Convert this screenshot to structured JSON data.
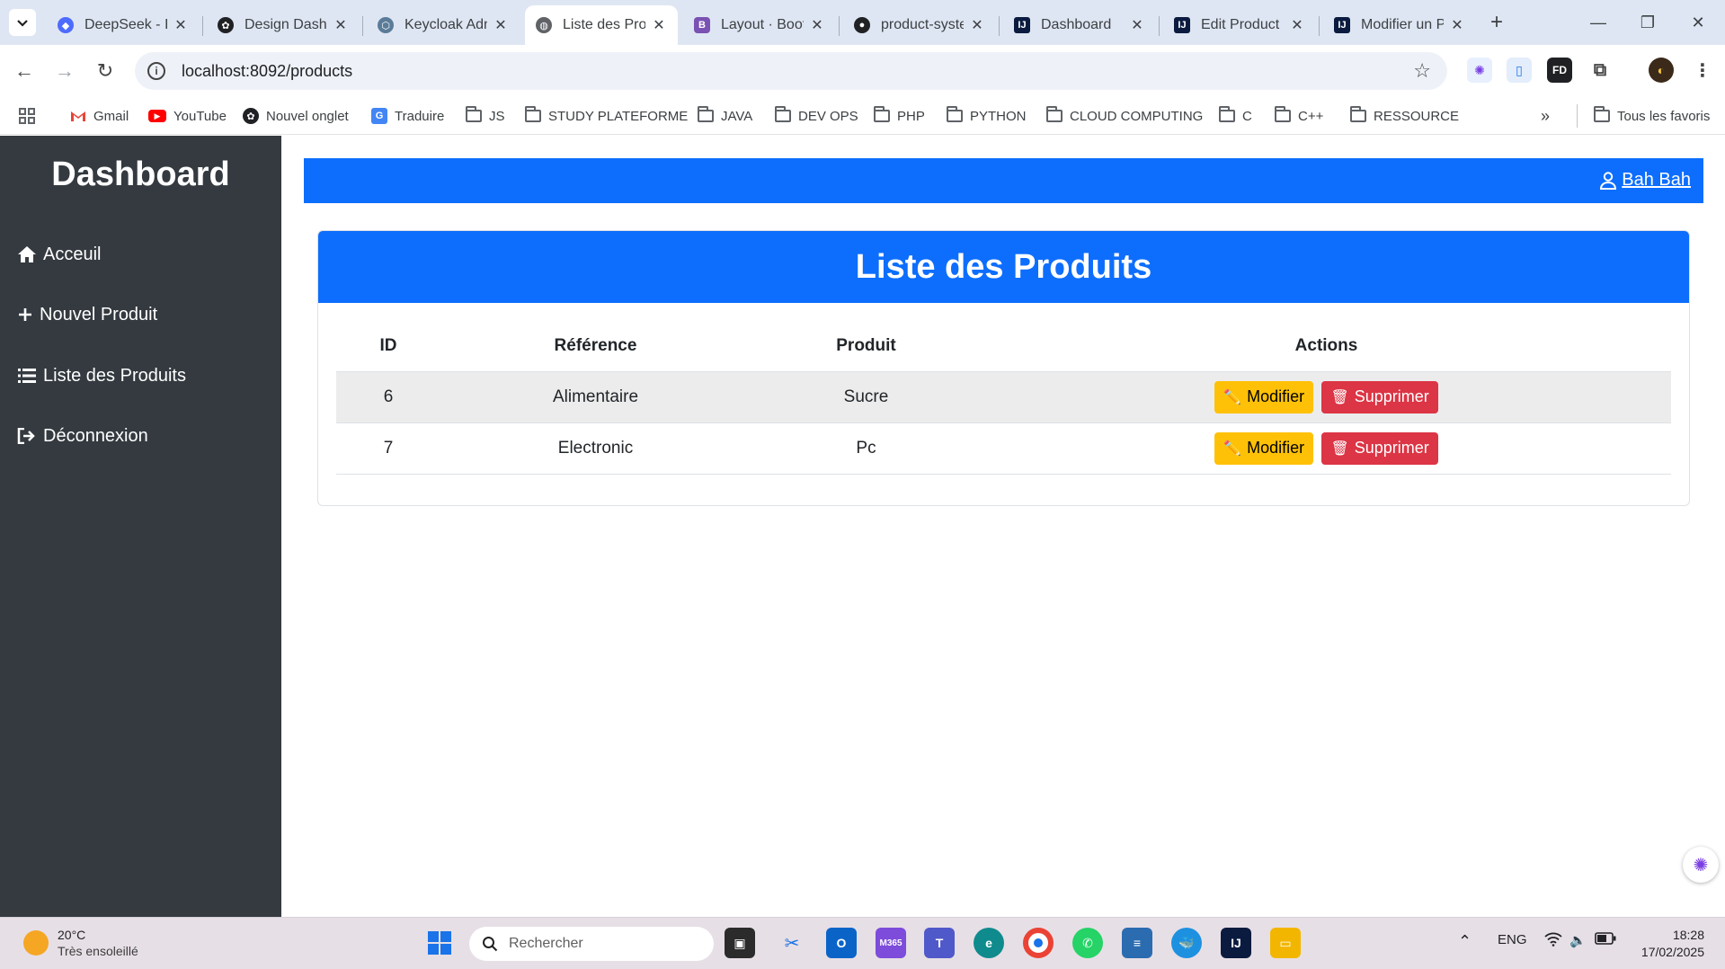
{
  "browser": {
    "tabs": [
      {
        "title": "DeepSeek - Ir",
        "favicon_color": "#4d6bfe",
        "active": false
      },
      {
        "title": "Design Dashb",
        "favicon_color": "#202124",
        "active": false
      },
      {
        "title": "Keycloak Adn",
        "favicon_color": "#5b7c99",
        "active": false
      },
      {
        "title": "Liste des Proc",
        "favicon_color": "#5f6368",
        "active": true
      },
      {
        "title": "Layout · Boot",
        "favicon_color": "#7952b3",
        "active": false
      },
      {
        "title": "product-syste",
        "favicon_color": "#202124",
        "active": false
      },
      {
        "title": "Dashboard",
        "favicon_color": "#0b1b3f",
        "active": false
      },
      {
        "title": "Edit Product",
        "favicon_color": "#0b1b3f",
        "active": false
      },
      {
        "title": "Modifier un P",
        "favicon_color": "#0b1b3f",
        "active": false
      }
    ],
    "url": "localhost:8092/products",
    "bookmarks": [
      {
        "label": "Gmail",
        "icon": "gmail-icon"
      },
      {
        "label": "YouTube",
        "icon": "youtube-icon"
      },
      {
        "label": "Nouvel onglet",
        "icon": "chatgpt-icon"
      },
      {
        "label": "Traduire",
        "icon": "translate-icon"
      },
      {
        "label": "JS",
        "icon": "folder-icon"
      },
      {
        "label": "STUDY PLATEFORME",
        "icon": "folder-icon"
      },
      {
        "label": "JAVA",
        "icon": "folder-icon"
      },
      {
        "label": "DEV OPS",
        "icon": "folder-icon"
      },
      {
        "label": "PHP",
        "icon": "folder-icon"
      },
      {
        "label": "PYTHON",
        "icon": "folder-icon"
      },
      {
        "label": "CLOUD COMPUTING",
        "icon": "folder-icon"
      },
      {
        "label": "C",
        "icon": "folder-icon"
      },
      {
        "label": "C++",
        "icon": "folder-icon"
      },
      {
        "label": "RESSOURCE",
        "icon": "folder-icon"
      }
    ],
    "all_bookmarks_label": "Tous les favoris"
  },
  "sidebar": {
    "brand": "Dashboard",
    "items": [
      {
        "label": "Acceuil",
        "icon": "home-icon"
      },
      {
        "label": "Nouvel Produit",
        "icon": "plus-icon"
      },
      {
        "label": "Liste des Produits",
        "icon": "list-icon"
      },
      {
        "label": "Déconnexion",
        "icon": "logout-icon"
      }
    ]
  },
  "topbar": {
    "user_name": "Bah Bah"
  },
  "main": {
    "card_title": "Liste des Produits",
    "table": {
      "headers": [
        "ID",
        "Référence",
        "Produit",
        "Actions"
      ],
      "rows": [
        {
          "id": "6",
          "reference": "Alimentaire",
          "produit": "Sucre"
        },
        {
          "id": "7",
          "reference": "Electronic",
          "produit": "Pc"
        }
      ],
      "edit_label": "Modifier",
      "delete_label": "Supprimer"
    }
  },
  "colors": {
    "primary": "#0d6efd",
    "sidebar": "#343a40",
    "warning": "#ffc107",
    "danger": "#dc3545"
  },
  "taskbar": {
    "temperature": "20°C",
    "weather": "Très ensoleillé",
    "search_placeholder": "Rechercher",
    "language": "ENG",
    "time": "18:28",
    "date": "17/02/2025"
  }
}
